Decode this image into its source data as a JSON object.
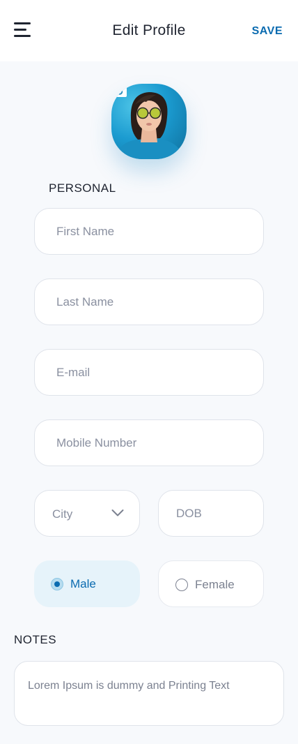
{
  "header": {
    "title": "Edit Profile",
    "save_label": "SAVE"
  },
  "icons": {
    "menu": "menu-icon",
    "camera": "camera-icon",
    "chevron": "chevron-down-icon"
  },
  "colors": {
    "accent": "#0a6bb0",
    "selected_bg": "#e6f3fa",
    "placeholder": "#8a90a0"
  },
  "sections": {
    "personal": "PERSONAL",
    "notes": "NOTES"
  },
  "fields": {
    "first_name": {
      "placeholder": "First Name",
      "value": ""
    },
    "last_name": {
      "placeholder": "Last Name",
      "value": ""
    },
    "email": {
      "placeholder": "E-mail",
      "value": ""
    },
    "mobile": {
      "placeholder": "Mobile Number",
      "value": ""
    },
    "city": {
      "placeholder": "City"
    },
    "dob": {
      "placeholder": "DOB",
      "value": ""
    }
  },
  "gender": {
    "options": [
      "Male",
      "Female"
    ],
    "selected": "Male"
  },
  "notes": {
    "value": "Lorem Ipsum is dummy and Printing Text"
  }
}
